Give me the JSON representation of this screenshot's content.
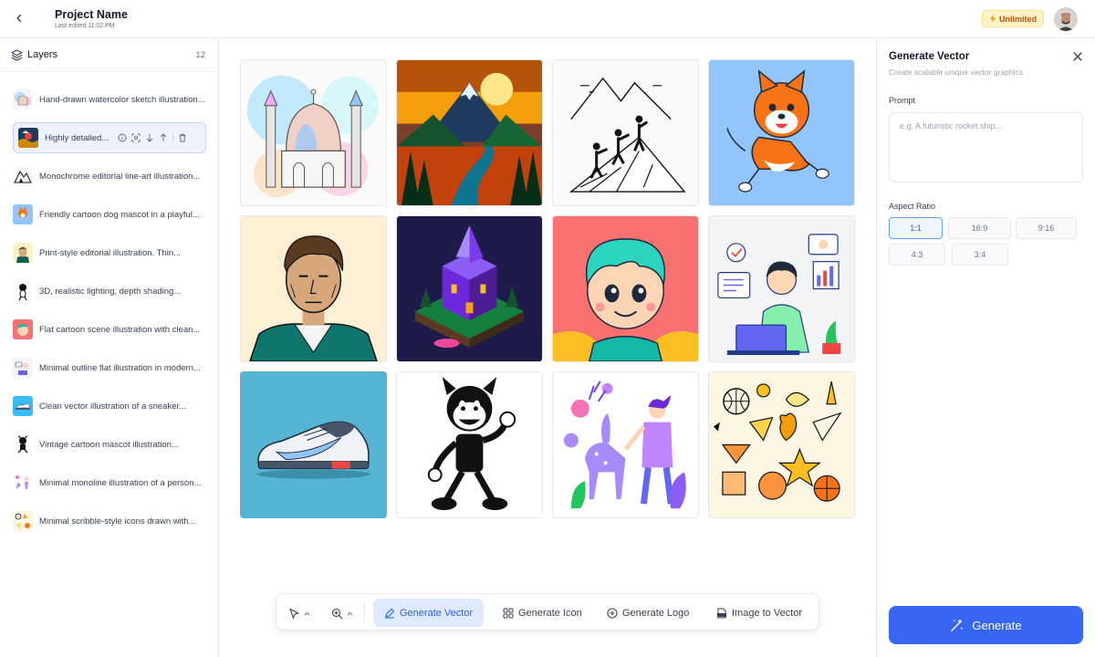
{
  "header": {
    "project_name": "Project Name",
    "last_edited": "Last edited 11:02 PM",
    "plan_badge": "Unlimited",
    "back_icon": "chevron-left-icon",
    "badge_icon": "lightning-icon"
  },
  "layers": {
    "title": "Layers",
    "count": "12",
    "items": [
      {
        "label": "Hand-drawn watercolor sketch illustration..."
      },
      {
        "label": "Highly detailed..."
      },
      {
        "label": "Monochrome editorial line-art illustration..."
      },
      {
        "label": "Friendly cartoon dog mascot in a playful..."
      },
      {
        "label": "Print-style editorial illustration. Thin..."
      },
      {
        "label": "3D, realistic lighting, depth shading..."
      },
      {
        "label": "Flat cartoon scene illustration with clean..."
      },
      {
        "label": "Minimal outline flat illustration in modern..."
      },
      {
        "label": "Clean vector illustration of a sneaker..."
      },
      {
        "label": "Vintage cartoon mascot illustration..."
      },
      {
        "label": "Minimal monoline illustration of a person..."
      },
      {
        "label": "Minimal scribble-style icons drawn with..."
      }
    ],
    "selected_actions": [
      "info-icon",
      "focus-icon",
      "move-down-icon",
      "move-up-icon",
      "trash-icon"
    ]
  },
  "gallery": {
    "tiles": [
      {
        "name": "tile-watercolor-mosque"
      },
      {
        "name": "tile-mountain-landscape"
      },
      {
        "name": "tile-hikers-lineart"
      },
      {
        "name": "tile-cartoon-dog"
      },
      {
        "name": "tile-editorial-portrait"
      },
      {
        "name": "tile-isometric-castle"
      },
      {
        "name": "tile-cartoon-boy"
      },
      {
        "name": "tile-person-laptop"
      },
      {
        "name": "tile-sneaker"
      },
      {
        "name": "tile-vintage-mascot"
      },
      {
        "name": "tile-woman-deer"
      },
      {
        "name": "tile-scribble-icons"
      }
    ]
  },
  "toolbar": {
    "generate_vector": "Generate Vector",
    "generate_icon": "Generate Icon",
    "generate_logo": "Generate Logo",
    "image_to_vector": "Image to Vector"
  },
  "panel": {
    "title": "Generate Vector",
    "subtitle": "Create scalable unique vector graphics",
    "prompt_label": "Prompt",
    "prompt_placeholder": "e.g. A futuristic rocket ship...",
    "aspect_label": "Aspect Ratio",
    "ratios": [
      "1:1",
      "16:9",
      "9:16",
      "4:3",
      "3:4"
    ],
    "selected_ratio": "1:1",
    "generate_label": "Generate"
  },
  "colors": {
    "accent": "#3767f2",
    "active_tab_bg": "#e0eaff",
    "badge_bg": "#fef3c7",
    "badge_text": "#b45309"
  }
}
